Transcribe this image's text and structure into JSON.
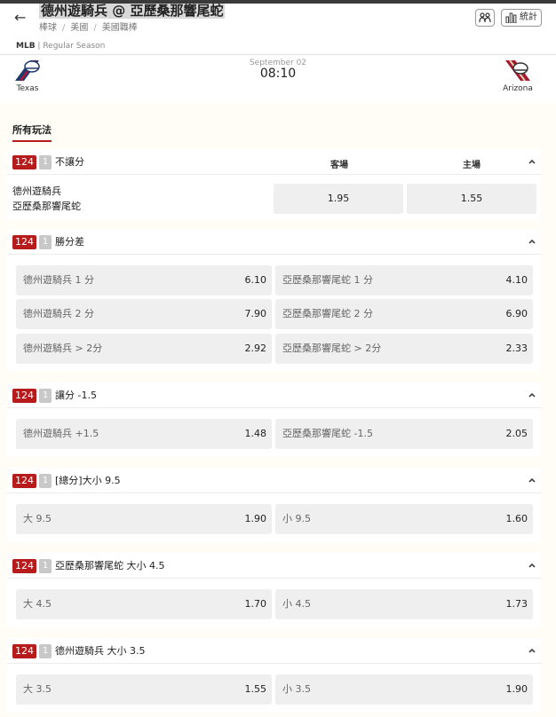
{
  "header": {
    "title": "德州遊騎兵 @ 亞歷桑那響尾蛇",
    "breadcrumbs": [
      "棒球",
      "美國",
      "美國職棒"
    ],
    "stats_label": "統計"
  },
  "league": {
    "name": "MLB",
    "season": "Regular Season"
  },
  "match": {
    "home": "Texas",
    "away": "Arizona",
    "date": "September 02",
    "time": "08:10"
  },
  "tab": {
    "label": "所有玩法"
  },
  "markets": [
    {
      "id": "124",
      "count": "1",
      "title": "不讓分",
      "col_away": "客場",
      "col_home": "主場",
      "team1": "德州遊騎兵",
      "team2": "亞歷桑那響尾蛇",
      "odd_away": "1.95",
      "odd_home": "1.55"
    },
    {
      "id": "124",
      "count": "1",
      "title": "勝分差",
      "rows": [
        [
          {
            "label": "德州遊騎兵 1 分",
            "odd": "6.10"
          },
          {
            "label": "亞歷桑那響尾蛇 1 分",
            "odd": "4.10"
          }
        ],
        [
          {
            "label": "德州遊騎兵 2 分",
            "odd": "7.90"
          },
          {
            "label": "亞歷桑那響尾蛇 2 分",
            "odd": "6.90"
          }
        ],
        [
          {
            "label": "德州遊騎兵 > 2分",
            "odd": "2.92"
          },
          {
            "label": "亞歷桑那響尾蛇 > 2分",
            "odd": "2.33"
          }
        ]
      ]
    },
    {
      "id": "124",
      "count": "1",
      "title": "讓分 -1.5",
      "rows": [
        [
          {
            "label": "德州遊騎兵 +1.5",
            "odd": "1.48"
          },
          {
            "label": "亞歷桑那響尾蛇 -1.5",
            "odd": "2.05"
          }
        ]
      ]
    },
    {
      "id": "124",
      "count": "1",
      "title": "[總分]大小 9.5",
      "rows": [
        [
          {
            "label": "大 9.5",
            "odd": "1.90"
          },
          {
            "label": "小 9.5",
            "odd": "1.60"
          }
        ]
      ]
    },
    {
      "id": "124",
      "count": "1",
      "title": "亞歷桑那響尾蛇 大小 4.5",
      "rows": [
        [
          {
            "label": "大 4.5",
            "odd": "1.70"
          },
          {
            "label": "小 4.5",
            "odd": "1.73"
          }
        ]
      ]
    },
    {
      "id": "124",
      "count": "1",
      "title": "德州遊騎兵 大小 3.5",
      "rows": [
        [
          {
            "label": "大 3.5",
            "odd": "1.55"
          },
          {
            "label": "小 3.5",
            "odd": "1.90"
          }
        ]
      ]
    }
  ],
  "colors": {
    "accent": "#b71c1c",
    "badge_grey": "#c8c8c8",
    "cell_bg": "#efefef"
  },
  "icons": [
    "back-arrow-icon",
    "lineup-icon",
    "bar-chart-icon",
    "chevron-up-icon",
    "baseball-helmet-icon"
  ]
}
